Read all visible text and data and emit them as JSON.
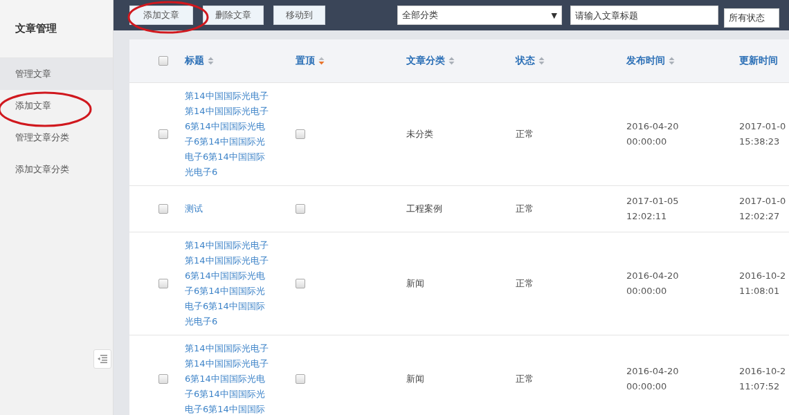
{
  "sidebar": {
    "title": "文章管理",
    "items": [
      {
        "label": "管理文章",
        "selected": true
      },
      {
        "label": "添加文章",
        "selected": false
      },
      {
        "label": "管理文章分类",
        "selected": false
      },
      {
        "label": "添加文章分类",
        "selected": false
      }
    ]
  },
  "toolbar": {
    "buttons": [
      "添加文章",
      "删除文章",
      "移动到"
    ],
    "category_select": {
      "value": "全部分类",
      "arrow": "▼"
    },
    "search": {
      "placeholder": "请输入文章标题"
    },
    "status_select": {
      "value": "所有状态"
    }
  },
  "table": {
    "select_all_checked": false,
    "columns": [
      {
        "label": "标题",
        "sort_active": false
      },
      {
        "label": "置顶",
        "sort_active": true
      },
      {
        "label": "文章分类",
        "sort_active": false
      },
      {
        "label": "状态",
        "sort_active": false
      },
      {
        "label": "发布时间",
        "sort_active": false
      },
      {
        "label": "更新时间"
      }
    ],
    "rows": [
      {
        "checked": false,
        "title": "第14中国国际光电子第14中国国际光电子6第14中国国际光电子6第14中国国际光电子6第14中国国际光电子6",
        "pinned": false,
        "category": "未分类",
        "status": "正常",
        "published": [
          "2016-04-20",
          "00:00:00"
        ],
        "updated": [
          "2017-01-0",
          "15:38:23"
        ]
      },
      {
        "checked": false,
        "title": "测试",
        "pinned": false,
        "category": "工程案例",
        "status": "正常",
        "published": [
          "2017-01-05",
          "12:02:11"
        ],
        "updated": [
          "2017-01-0",
          "12:02:27"
        ]
      },
      {
        "checked": false,
        "title": "第14中国国际光电子第14中国国际光电子6第14中国国际光电子6第14中国国际光电子6第14中国国际光电子6",
        "pinned": false,
        "category": "新闻",
        "status": "正常",
        "published": [
          "2016-04-20",
          "00:00:00"
        ],
        "updated": [
          "2016-10-2",
          "11:08:01"
        ]
      },
      {
        "checked": false,
        "title": "第14中国国际光电子第14中国国际光电子6第14中国国际光电子6第14中国国际光电子6第14中国国际",
        "pinned": false,
        "category": "新闻",
        "status": "正常",
        "published": [
          "2016-04-20",
          "00:00:00"
        ],
        "updated": [
          "2016-10-2",
          "11:07:52"
        ]
      }
    ]
  }
}
